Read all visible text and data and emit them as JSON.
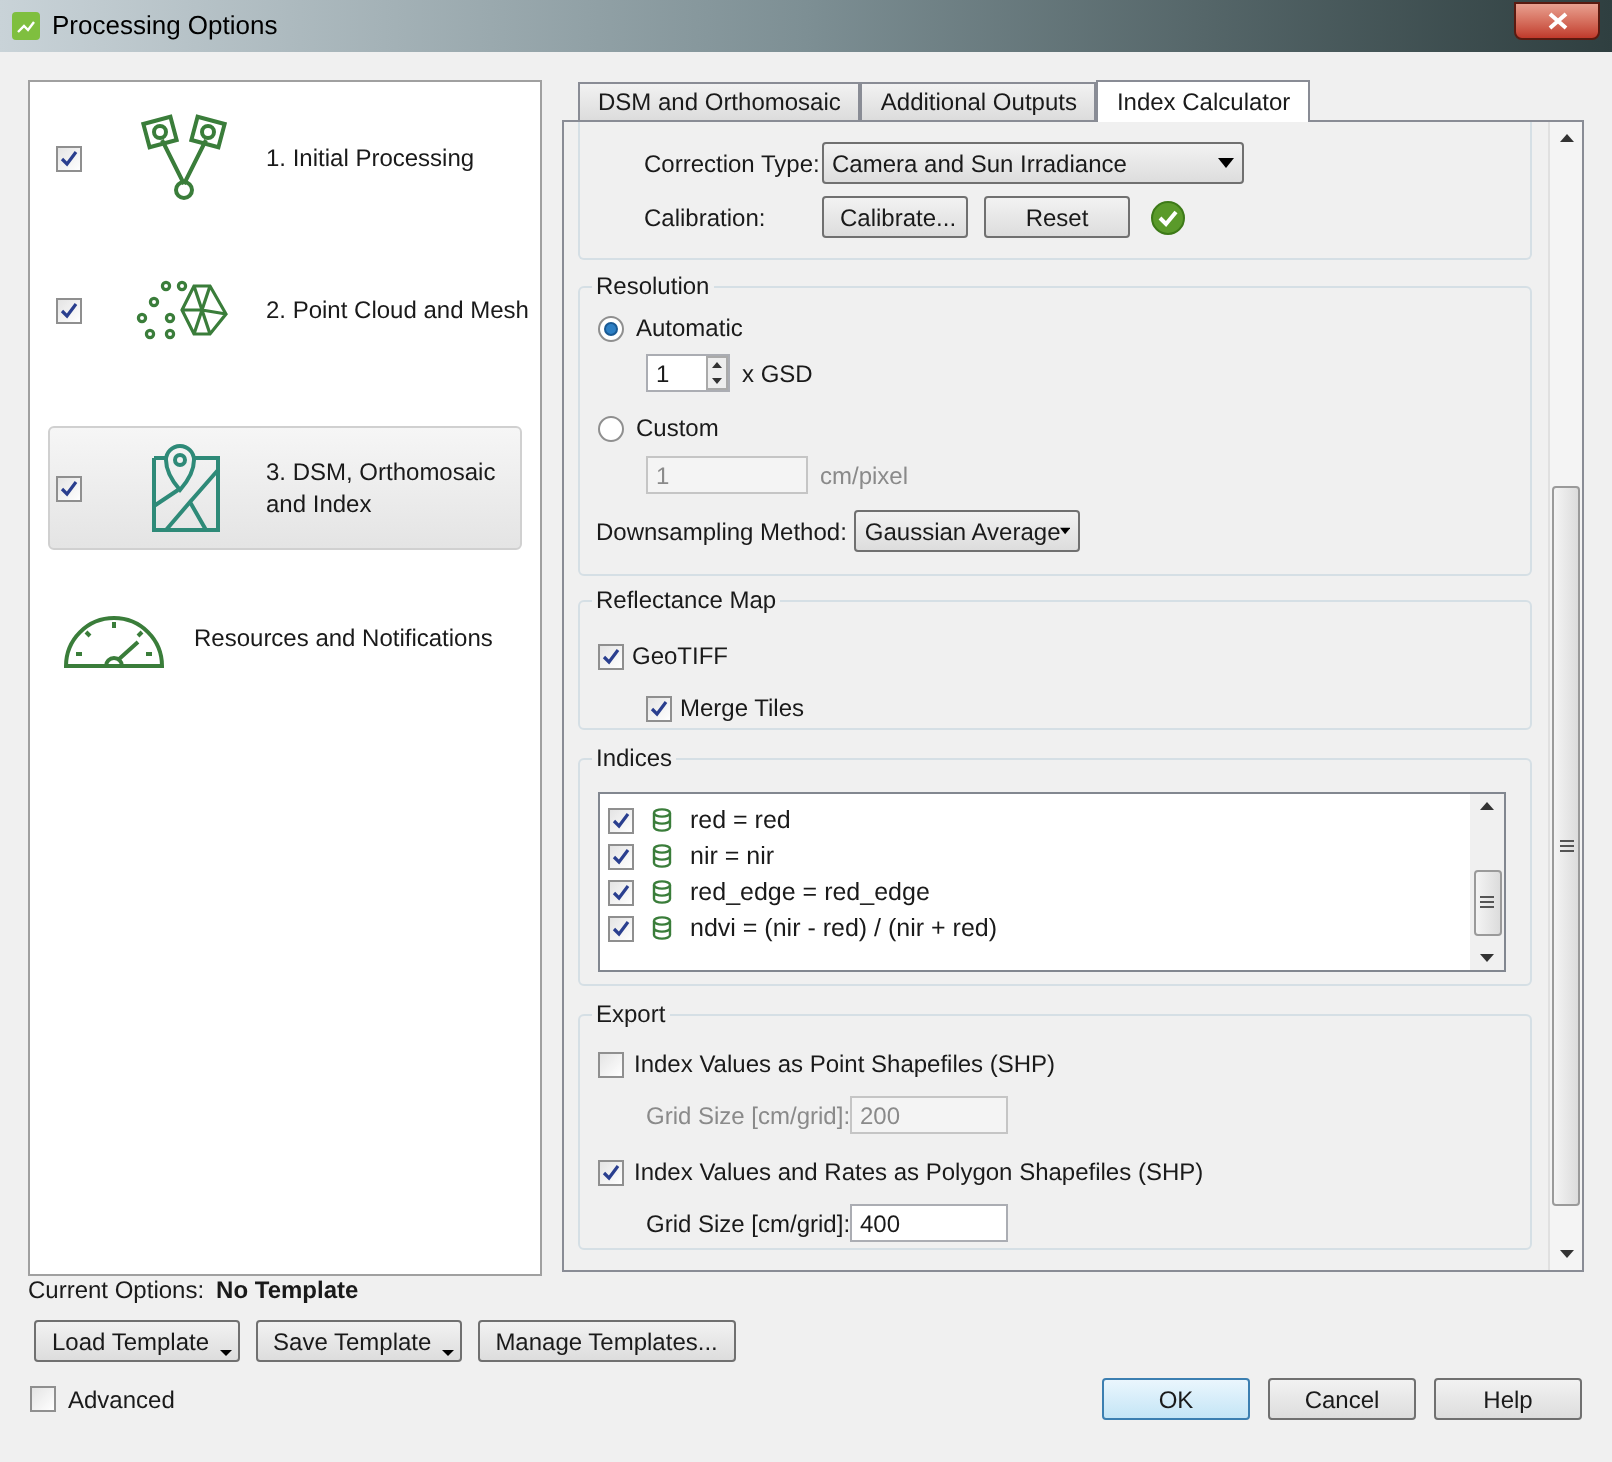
{
  "window": {
    "title": "Processing Options"
  },
  "steps": [
    {
      "label": "1. Initial Processing",
      "kind": "cameras",
      "checked": true,
      "selected": false
    },
    {
      "label": "2. Point Cloud and Mesh",
      "kind": "points",
      "checked": true,
      "selected": false
    },
    {
      "label": "3. DSM, Orthomosaic and Index",
      "kind": "map",
      "checked": true,
      "selected": true
    },
    {
      "label": "Resources and Notifications",
      "kind": "gauge",
      "selected": false
    }
  ],
  "tabs": [
    {
      "label": "DSM and Orthomosaic",
      "selected": false
    },
    {
      "label": "Additional Outputs",
      "selected": false
    },
    {
      "label": "Index Calculator",
      "selected": true
    }
  ],
  "radiometric": {
    "correction_type": {
      "label": "Correction Type:",
      "value": "Camera and Sun Irradiance"
    },
    "calibration": {
      "label": "Calibration:",
      "buttons": [
        "Calibrate...",
        "Reset"
      ],
      "calibrated": true
    }
  },
  "resolution": {
    "title": "Resolution",
    "options": [
      {
        "label": "Automatic",
        "selected": true
      },
      {
        "label": "Custom",
        "selected": false
      }
    ],
    "gsd": {
      "value": "1",
      "unit": "x GSD"
    },
    "custom": {
      "value": "1",
      "unit": "cm/pixel",
      "disabled": true
    },
    "downsampling": {
      "label": "Downsampling Method:",
      "value": "Gaussian Average"
    }
  },
  "reflectance_map": {
    "title": "Reflectance Map",
    "geotiff": {
      "label": "GeoTIFF",
      "checked": true
    },
    "merge_tiles": {
      "label": "Merge Tiles",
      "checked": true
    }
  },
  "indices": {
    "title": "Indices",
    "items": [
      {
        "formula": "red = red",
        "checked": true
      },
      {
        "formula": "nir = nir",
        "checked": true
      },
      {
        "formula": "red_edge = red_edge",
        "checked": true
      },
      {
        "formula": "ndvi = (nir - red) / (nir + red)",
        "checked": true
      }
    ]
  },
  "export": {
    "title": "Export",
    "options": [
      {
        "label": "Index Values as Point Shapefiles (SHP)",
        "checked": false,
        "grid_label": "Grid Size [cm/grid]:",
        "grid_value": "200"
      },
      {
        "label": "Index Values and Rates as Polygon Shapefiles (SHP)",
        "checked": true,
        "grid_label": "Grid Size [cm/grid]:",
        "grid_value": "400"
      }
    ]
  },
  "current_options": {
    "label": "Current Options:",
    "value": "No Template"
  },
  "template_buttons": [
    {
      "label": "Load Template",
      "dropdown": true
    },
    {
      "label": "Save Template",
      "dropdown": true
    },
    {
      "label": "Manage Templates...",
      "dropdown": false
    }
  ],
  "advanced": {
    "label": "Advanced",
    "checked": false
  },
  "dialog_buttons": [
    {
      "label": "OK",
      "default": true
    },
    {
      "label": "Cancel",
      "default": false
    },
    {
      "label": "Help",
      "default": false
    }
  ]
}
